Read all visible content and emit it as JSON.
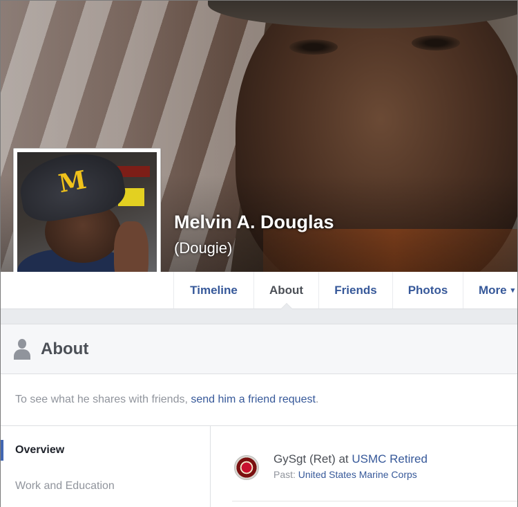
{
  "profile": {
    "name": "Melvin A. Douglas",
    "nickname": "(Dougie)"
  },
  "tabs": [
    {
      "label": "Timeline",
      "active": false
    },
    {
      "label": "About",
      "active": true
    },
    {
      "label": "Friends",
      "active": false
    },
    {
      "label": "Photos",
      "active": false
    },
    {
      "label": "More",
      "active": false
    }
  ],
  "more_caret": "▾",
  "about": {
    "title": "About",
    "notice_prefix": "To see what he shares with friends, ",
    "notice_link": "send him a friend request",
    "notice_suffix": "."
  },
  "sidenav": {
    "items": [
      {
        "label": "Overview",
        "active": true
      },
      {
        "label": "Work and Education",
        "active": false
      }
    ]
  },
  "work": {
    "role_prefix": "GySgt (Ret) at ",
    "employer": "USMC Retired",
    "past_label": "Past: ",
    "past_employer": "United States Marine Corps"
  },
  "colors": {
    "link": "#365899",
    "active_nav_bar": "#4267b2",
    "muted_text": "#90949c"
  },
  "cap_letter": "M"
}
